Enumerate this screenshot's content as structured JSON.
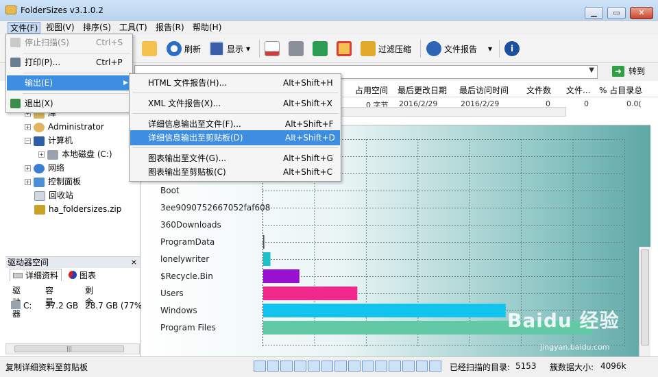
{
  "window": {
    "title": "FolderSizes v3.1.0.2",
    "min": "▁",
    "max": "▭",
    "close": "✕"
  },
  "menubar": [
    "文件(F)",
    "视图(V)",
    "排序(S)",
    "工具(T)",
    "报告(R)",
    "帮助(H)"
  ],
  "toolbar": {
    "refresh": "刷新",
    "display": "显示",
    "filter": "过滤压缩",
    "report": "文件报告",
    "dropdown": "▾",
    "info": "i"
  },
  "pathbar": {
    "goto": "转到",
    "dropdown": "▼",
    "arrow": "➜"
  },
  "file_menu": [
    {
      "label": "停止扫描(S)",
      "shortcut": "Ctrl+S",
      "disabled": true
    },
    {
      "label": "打印(P)...",
      "shortcut": "Ctrl+P"
    },
    {
      "label": "输出(E)",
      "submenu": true
    },
    {
      "label": "退出(X)",
      "shortcut": ""
    }
  ],
  "submenu_arrow": "▶",
  "export_menu": [
    {
      "label": "HTML 文件报告(H)...",
      "shortcut": "Alt+Shift+H"
    },
    {
      "label": "XML 文件报告(X)...",
      "shortcut": "Alt+Shift+X"
    },
    {
      "label": "详细信息输出至文件(F)...",
      "shortcut": "Alt+Shift+F"
    },
    {
      "label": "详细信息输出至剪贴板(D)",
      "shortcut": "Alt+Shift+D"
    },
    {
      "label": "图表输出至文件(G)...",
      "shortcut": "Alt+Shift+G"
    },
    {
      "label": "图表输出至剪贴板(C)",
      "shortcut": "Alt+Shift+C"
    }
  ],
  "tree": [
    "库",
    "Administrator",
    "计算机",
    "本地磁盘 (C:)",
    "网络",
    "控制面板",
    "回收站",
    "ha_foldersizes.zip"
  ],
  "tree_toggles": [
    "+",
    "+",
    "−",
    "+",
    "+",
    "+",
    "",
    ""
  ],
  "drive_panel": {
    "title": "驱动器空间",
    "close": "×",
    "tabs": [
      "详细资料",
      "图表"
    ],
    "columns": [
      "驱动器",
      "容量",
      "剩余"
    ],
    "row": [
      "C:",
      "37.2 GB",
      "28.7 GB (77%"
    ]
  },
  "columns": [
    "占用空间",
    "最后更改日期",
    "最后访问时间",
    "文件数",
    "文件...",
    "% 占目录总"
  ],
  "row": [
    "0 字节",
    "2016/2/29",
    "2016/2/29",
    "0",
    "0",
    "0.0("
  ],
  "chart_data": {
    "type": "bar",
    "orientation": "horizontal",
    "categories": [
      "Boot",
      "3ee9090752667052faf608",
      "360Downloads",
      "ProgramData",
      "lonelywriter",
      "$Recycle.Bin",
      "Users",
      "Windows",
      "Program Files"
    ],
    "values": [
      0,
      0,
      0,
      0.3,
      2,
      10,
      26,
      67,
      91
    ],
    "colors": [
      "#888888",
      "#888888",
      "#888888",
      "#555555",
      "#1fbfc7",
      "#9a10d0",
      "#f0288c",
      "#10c4ee",
      "#63c8a6"
    ],
    "xlim": [
      0,
      100
    ],
    "grid": true
  },
  "status": {
    "left": "复制详细资料至剪贴板",
    "scanned_label": "已经扫描的目录:",
    "scanned_value": "5153",
    "cluster_label": "簇数据大小:",
    "cluster_value": "4096k"
  },
  "progress_cells": 14,
  "watermark": {
    "text": "Baidu 经验",
    "sub": "jingyan.baidu.com"
  },
  "scroll_glyph": "|||"
}
